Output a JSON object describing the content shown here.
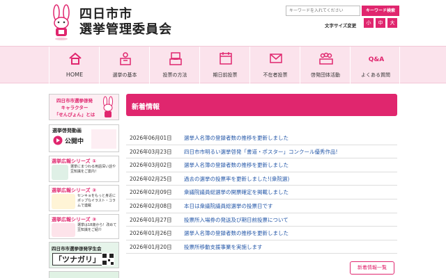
{
  "header": {
    "title_line1": "四日市市",
    "title_line2": "選挙管理委員会",
    "search_placeholder": "キーワードを入れてください",
    "search_button": "キーワード検索",
    "fontsize_label": "文字サイズ変更",
    "fontsize_small": "小",
    "fontsize_medium": "中",
    "fontsize_large": "大"
  },
  "nav": [
    {
      "label": "HOME",
      "icon": "home-icon"
    },
    {
      "label": "選挙の基本",
      "icon": "ballot-box-icon"
    },
    {
      "label": "投票の方法",
      "icon": "voting-icon"
    },
    {
      "label": "期日前投票",
      "icon": "calendar-icon"
    },
    {
      "label": "不在者投票",
      "icon": "envelope-icon"
    },
    {
      "label": "啓発団体活動",
      "icon": "group-icon"
    },
    {
      "label": "よくある質問",
      "icon": "qa-icon"
    }
  ],
  "sidebar": {
    "banner1_line1": "四日市市選挙啓発",
    "banner1_line2": "キャラクター",
    "banner1_line3": "「せんぴょん」とは",
    "video_title": "選挙啓発動画",
    "video_status": "公開中",
    "series1_title": "選挙広報シリーズ ①",
    "series1_text": "選挙にまつわる用語深い話や豆知識をご案内！",
    "series2_title": "選挙広報シリーズ ②",
    "series2_text": "センキョをもっと身近にポップなイラスト・コラムで連載",
    "series3_title": "選挙広報シリーズ ③",
    "series3_text": "選挙は18歳から！改めて豆知識をご紹介",
    "student_title": "四日市市選挙啓発学生会",
    "student_name": "「ツナガリ」"
  },
  "news": {
    "heading": "新着情報",
    "more_label": "新着情報一覧",
    "items": [
      {
        "date": "2026年06月01日",
        "text": "選挙人名簿の登録者数の推移を更新しました"
      },
      {
        "date": "2026年03月23日",
        "text": "四日市市明るい選挙啓発「書道・ポスター」コンクール優秀作品!"
      },
      {
        "date": "2026年03月02日",
        "text": "選挙人名簿の登録者数の推移を更新しました"
      },
      {
        "date": "2026年02月25日",
        "text": "過去の選挙の投票率を更新しました!(衆院選)"
      },
      {
        "date": "2026年02月09日",
        "text": "衆議院議員総選挙の開票確定を掲載しました"
      },
      {
        "date": "2026年02月08日",
        "text": "本日は衆議院議員総選挙の投票日です"
      },
      {
        "date": "2026年01月27日",
        "text": "投票所入場券の発送及び期日前投票について"
      },
      {
        "date": "2026年01月26日",
        "text": "選挙人名簿の登録者数の推移を更新しました"
      },
      {
        "date": "2026年01月20日",
        "text": "投票所移動支援事業を実施します"
      }
    ]
  },
  "colors": {
    "accent": "#e0266e",
    "link": "#2457a8",
    "nav_bg": "#fbe3ec"
  }
}
